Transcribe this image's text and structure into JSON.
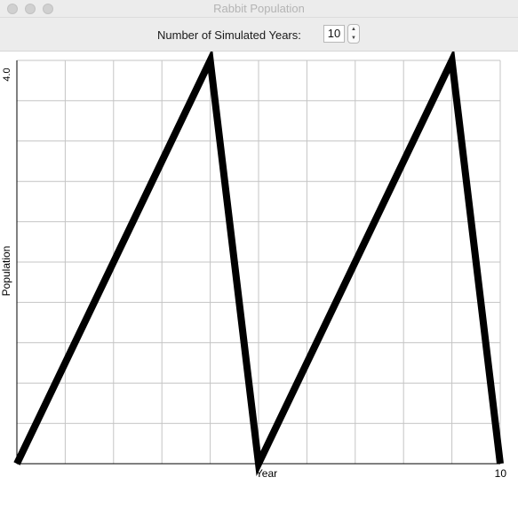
{
  "window": {
    "title": "Rabbit Population"
  },
  "controls": {
    "years_label": "Number of Simulated Years:",
    "years_value": "10",
    "step_up_icon": "chevron-up-icon",
    "step_down_icon": "chevron-down-icon"
  },
  "chart_data": {
    "type": "line",
    "xlabel": "Year",
    "ylabel": "Population",
    "x_max_label": "10",
    "y_max_label": "4.0",
    "xlim": [
      0,
      10
    ],
    "ylim": [
      0,
      4.0
    ],
    "grid": true,
    "series": [
      {
        "x": [
          0,
          4,
          5,
          9,
          10
        ],
        "values": [
          0,
          4.0,
          0,
          4.0,
          0
        ]
      }
    ]
  }
}
